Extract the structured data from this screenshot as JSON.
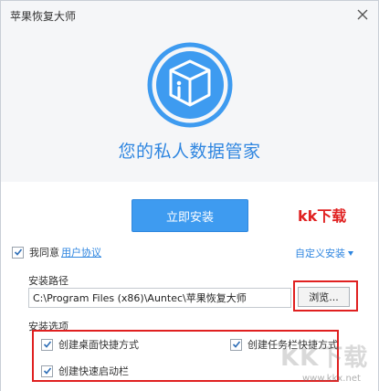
{
  "window": {
    "title": "苹果恢复大师"
  },
  "hero": {
    "slogan": "您的私人数据管家"
  },
  "actions": {
    "install_label": "立即安装",
    "custom_install_label": "自定义安装"
  },
  "agreement": {
    "checked": true,
    "label": "我同意",
    "link_label": "用户协议"
  },
  "path": {
    "label": "安装路径",
    "value": "C:\\Program Files (x86)\\Auntec\\苹果恢复大师",
    "browse_label": "浏览..."
  },
  "options": {
    "label": "安装选项",
    "items": [
      {
        "label": "创建桌面快捷方式",
        "checked": true
      },
      {
        "label": "创建任务栏快捷方式",
        "checked": true
      },
      {
        "label": "创建快速启动栏",
        "checked": true
      }
    ]
  },
  "watermark": {
    "overlay_label": "kk下载",
    "corner_big": "KK下载",
    "corner_small": "www.kkx.net"
  },
  "colors": {
    "accent": "#3e9bf0",
    "link": "#2f86e0",
    "highlight": "#e02020"
  },
  "icons": {
    "close": "close-icon",
    "logo": "cube-i-logo-icon",
    "check": "checkmark-icon",
    "dropdown": "caret-down-icon"
  }
}
